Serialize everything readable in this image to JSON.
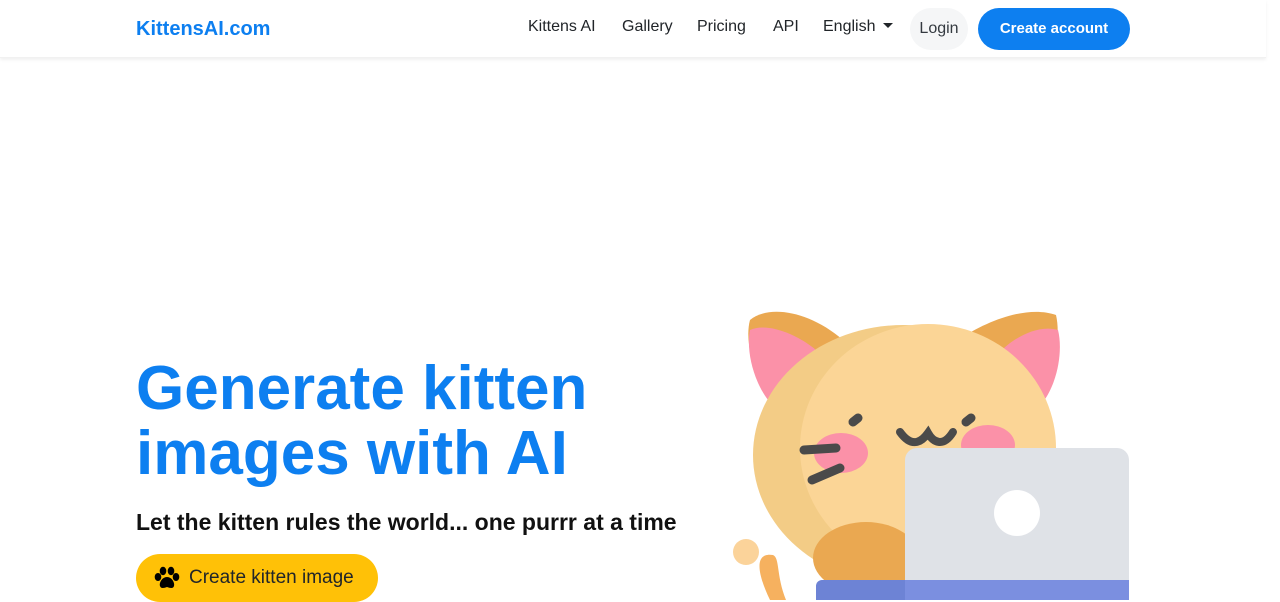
{
  "brand": "KittensAI.com",
  "nav": {
    "links": [
      "Kittens AI",
      "Gallery",
      "Pricing",
      "API"
    ],
    "language": "English",
    "login": "Login",
    "create_account": "Create account"
  },
  "hero": {
    "title": "Generate kitten images with AI",
    "subtitle": "Let the kitten rules the world... one purrr at a time",
    "cta": "Create kitten image"
  },
  "colors": {
    "brand": "#0d7ff0",
    "cta": "#ffc107"
  },
  "icons": [
    "paw-icon",
    "caret-down-icon"
  ]
}
